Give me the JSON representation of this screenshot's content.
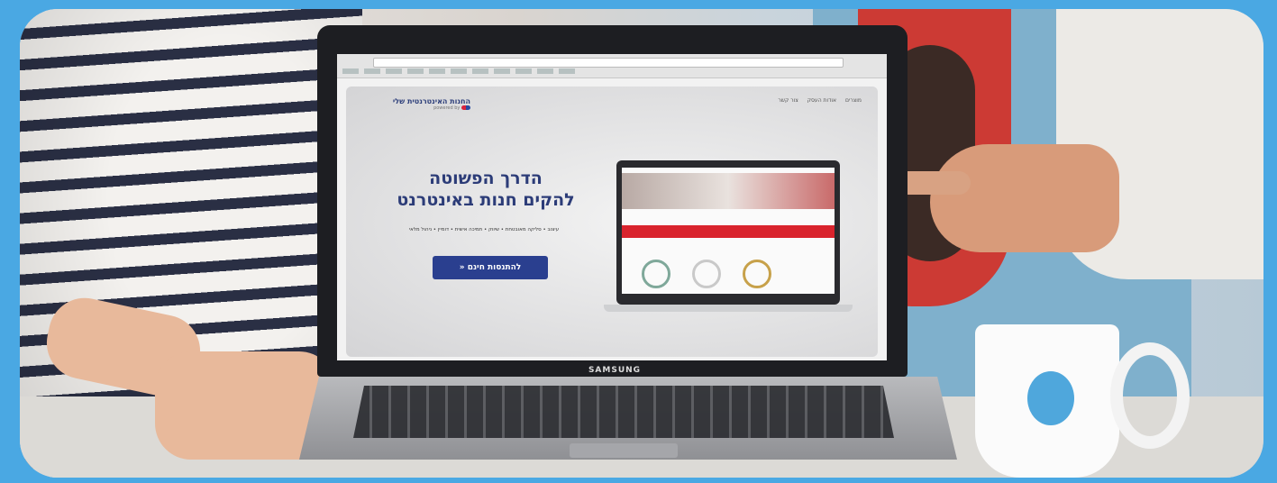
{
  "site": {
    "logo_title": "החנות האינטרנטית שלי",
    "logo_sub": "powered by",
    "nav": [
      "מוצרים",
      "אודות העסק",
      "צור קשר"
    ],
    "headline_line1": "הדרך הפשוטה",
    "headline_line2": "להקים חנות באינטרנט",
    "subline": "עיצוב • סליקה מאובטחת • שיווק • תמיכה אישית • דומיין • ניהול מלאי",
    "cta_label": "להתנסות חינם «"
  },
  "laptop": {
    "brand": "SAMSUNG"
  },
  "colors": {
    "frame_bg": "#4aa8e3",
    "cta": "#2a3f8f",
    "headline": "#2c3c78",
    "band": "#d9232d"
  }
}
